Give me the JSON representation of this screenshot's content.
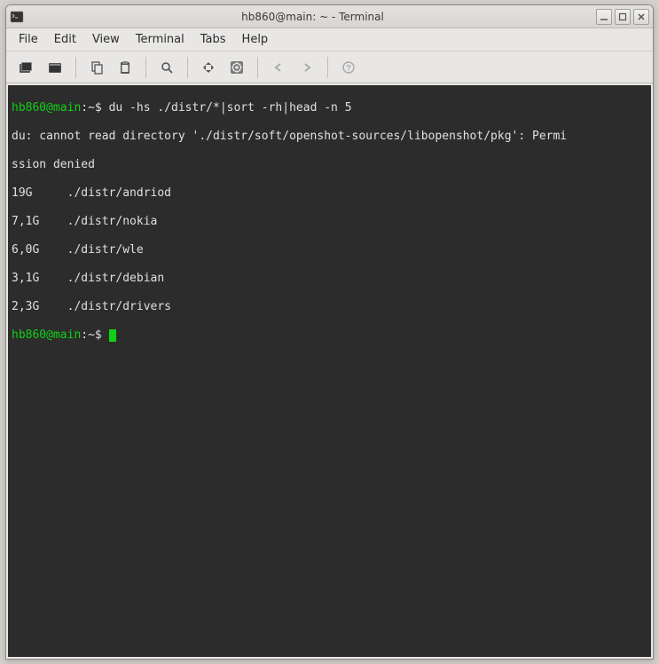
{
  "titlebar": {
    "title": "hb860@main: ~ - Terminal"
  },
  "menubar": {
    "file": "File",
    "edit": "Edit",
    "view": "View",
    "terminal": "Terminal",
    "tabs": "Tabs",
    "help": "Help"
  },
  "terminal": {
    "prompt1_user": "hb860@main",
    "prompt1_path": ":~$ ",
    "command1": "du -hs ./distr/*|sort -rh|head -n 5",
    "err_line1": "du: cannot read directory './distr/soft/openshot-sources/libopenshot/pkg': Permi",
    "err_line2": "ssion denied",
    "row1": "19G     ./distr/andriod",
    "row2": "7,1G    ./distr/nokia",
    "row3": "6,0G    ./distr/wle",
    "row4": "3,1G    ./distr/debian",
    "row5": "2,3G    ./distr/drivers",
    "prompt2_user": "hb860@main",
    "prompt2_path": ":~$ "
  }
}
